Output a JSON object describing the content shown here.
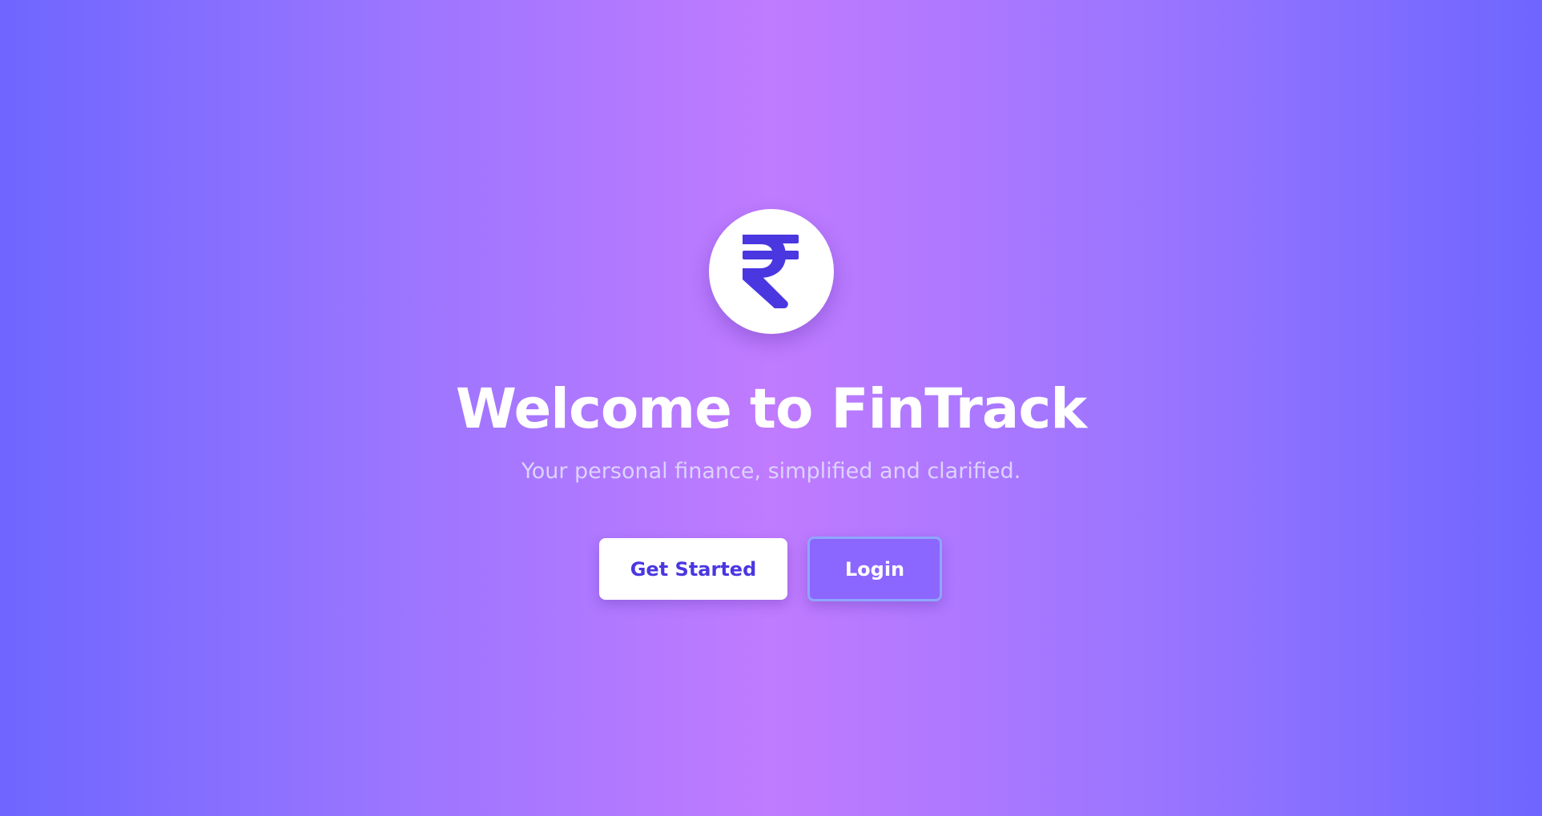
{
  "hero": {
    "logo_icon": "rupee-icon",
    "title": "Welcome to FinTrack",
    "subtitle": "Your personal finance, simplified and clarified."
  },
  "actions": {
    "get_started_label": "Get Started",
    "login_label": "Login"
  },
  "colors": {
    "accent": "#4a37e0",
    "background_edge": "#6e66ff",
    "background_center": "#c07bff"
  }
}
